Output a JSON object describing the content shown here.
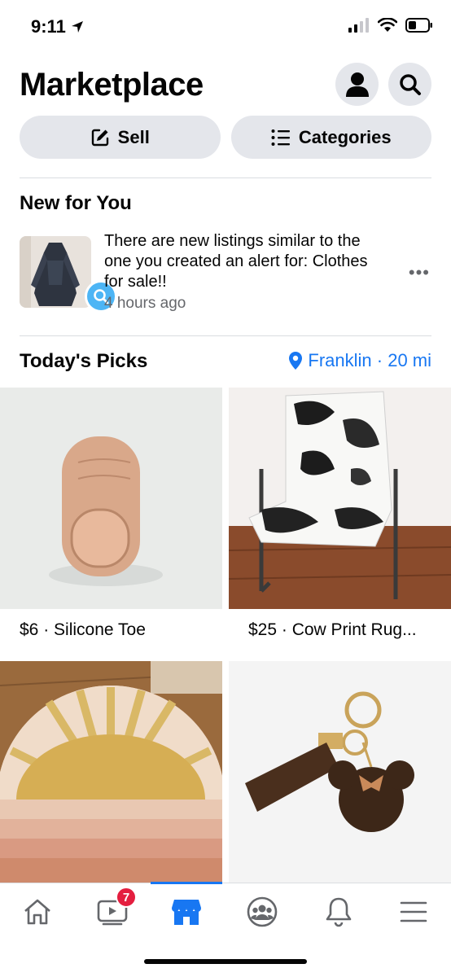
{
  "status_bar": {
    "time": "9:11"
  },
  "header": {
    "title": "Marketplace"
  },
  "actions": {
    "sell_label": "Sell",
    "categories_label": "Categories"
  },
  "new_for_you": {
    "title": "New for You",
    "alert_text": "There are new listings similar to the one you created an alert for: Clothes for sale!!",
    "time": "4 hours ago",
    "more": "•••"
  },
  "todays_picks": {
    "title": "Today's Picks",
    "location": "Franklin · 20 mi",
    "items": [
      {
        "label": "$6 · Silicone Toe"
      },
      {
        "label": "$25 · Cow Print Rug..."
      }
    ]
  },
  "tab_bar": {
    "video_badge": "7"
  },
  "colors": {
    "accent": "#1877f2",
    "pill_bg": "#e4e6eb",
    "badge": "#e41e3f"
  }
}
